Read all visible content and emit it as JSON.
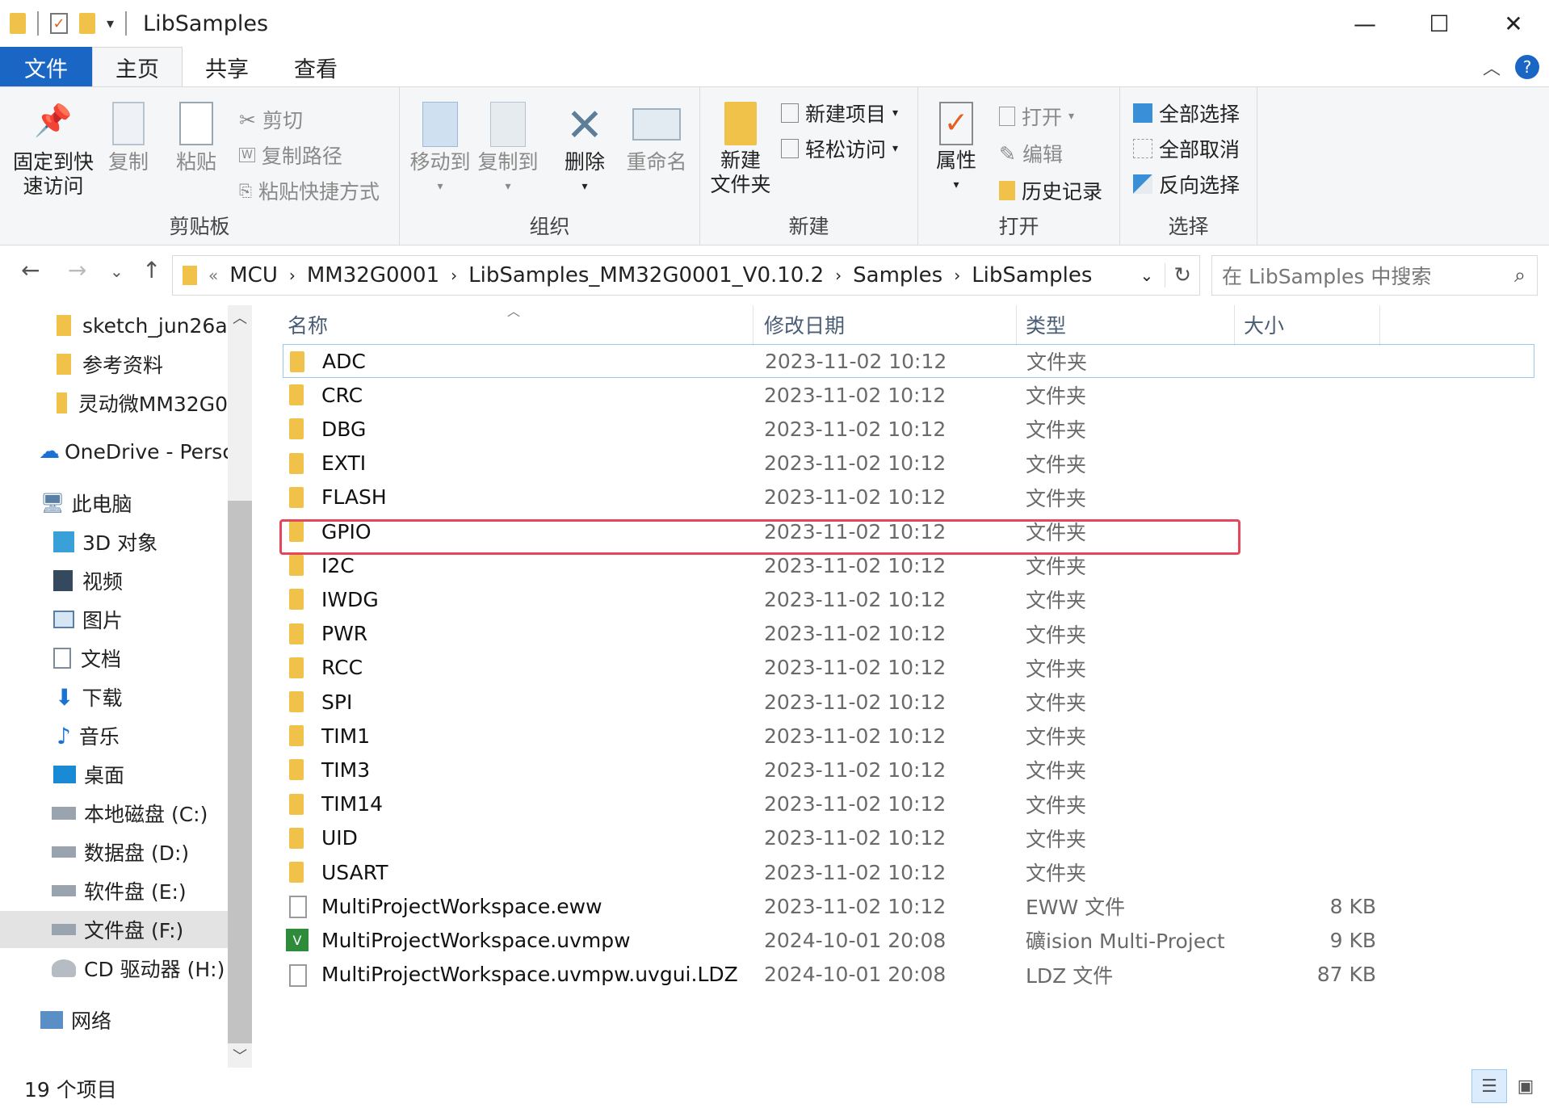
{
  "window": {
    "title": "LibSamples",
    "minimize": "—",
    "maximize": "☐",
    "close": "✕"
  },
  "tabs": [
    {
      "label": "文件"
    },
    {
      "label": "主页"
    },
    {
      "label": "共享"
    },
    {
      "label": "查看"
    }
  ],
  "ribbon": {
    "clipboard": {
      "label": "剪贴板",
      "pin": "固定到快\n速访问",
      "pin1": "固定到快",
      "pin2": "速访问",
      "copy": "复制",
      "paste": "粘贴",
      "cut": "剪切",
      "copy_path": "复制路径",
      "paste_shortcut": "粘贴快捷方式"
    },
    "organize": {
      "label": "组织",
      "move_to": "移动到",
      "copy_to": "复制到",
      "delete": "删除",
      "rename": "重命名"
    },
    "new": {
      "label": "新建",
      "new_folder1": "新建",
      "new_folder2": "文件夹",
      "new_item": "新建项目",
      "easy_access": "轻松访问"
    },
    "open": {
      "label": "打开",
      "properties": "属性",
      "open": "打开",
      "edit": "编辑",
      "history": "历史记录"
    },
    "select": {
      "label": "选择",
      "select_all": "全部选择",
      "select_none": "全部取消",
      "invert": "反向选择"
    }
  },
  "address": {
    "overflow": "«",
    "crumbs": [
      "MCU",
      "MM32G0001",
      "LibSamples_MM32G0001_V0.10.2",
      "Samples",
      "LibSamples"
    ],
    "search_placeholder": "在 LibSamples 中搜索"
  },
  "sidebar": {
    "items": [
      {
        "label": "sketch_jun26a"
      },
      {
        "label": "参考资料"
      },
      {
        "label": "灵动微MM32G0"
      },
      {
        "label": "OneDrive - Persc"
      },
      {
        "label": "此电脑"
      },
      {
        "label": "3D 对象"
      },
      {
        "label": "视频"
      },
      {
        "label": "图片"
      },
      {
        "label": "文档"
      },
      {
        "label": "下载"
      },
      {
        "label": "音乐"
      },
      {
        "label": "桌面"
      },
      {
        "label": "本地磁盘 (C:)"
      },
      {
        "label": "数据盘 (D:)"
      },
      {
        "label": "软件盘 (E:)"
      },
      {
        "label": "文件盘 (F:)"
      },
      {
        "label": "CD 驱动器 (H:)"
      },
      {
        "label": "网络"
      }
    ]
  },
  "columns": {
    "name": "名称",
    "date": "修改日期",
    "type": "类型",
    "size": "大小"
  },
  "files": [
    {
      "name": "ADC",
      "date": "2023-11-02 10:12",
      "type": "文件夹",
      "size": ""
    },
    {
      "name": "CRC",
      "date": "2023-11-02 10:12",
      "type": "文件夹",
      "size": ""
    },
    {
      "name": "DBG",
      "date": "2023-11-02 10:12",
      "type": "文件夹",
      "size": ""
    },
    {
      "name": "EXTI",
      "date": "2023-11-02 10:12",
      "type": "文件夹",
      "size": ""
    },
    {
      "name": "FLASH",
      "date": "2023-11-02 10:12",
      "type": "文件夹",
      "size": ""
    },
    {
      "name": "GPIO",
      "date": "2023-11-02 10:12",
      "type": "文件夹",
      "size": ""
    },
    {
      "name": "I2C",
      "date": "2023-11-02 10:12",
      "type": "文件夹",
      "size": ""
    },
    {
      "name": "IWDG",
      "date": "2023-11-02 10:12",
      "type": "文件夹",
      "size": ""
    },
    {
      "name": "PWR",
      "date": "2023-11-02 10:12",
      "type": "文件夹",
      "size": ""
    },
    {
      "name": "RCC",
      "date": "2023-11-02 10:12",
      "type": "文件夹",
      "size": ""
    },
    {
      "name": "SPI",
      "date": "2023-11-02 10:12",
      "type": "文件夹",
      "size": ""
    },
    {
      "name": "TIM1",
      "date": "2023-11-02 10:12",
      "type": "文件夹",
      "size": ""
    },
    {
      "name": "TIM3",
      "date": "2023-11-02 10:12",
      "type": "文件夹",
      "size": ""
    },
    {
      "name": "TIM14",
      "date": "2023-11-02 10:12",
      "type": "文件夹",
      "size": ""
    },
    {
      "name": "UID",
      "date": "2023-11-02 10:12",
      "type": "文件夹",
      "size": ""
    },
    {
      "name": "USART",
      "date": "2023-11-02 10:12",
      "type": "文件夹",
      "size": ""
    },
    {
      "name": "MultiProjectWorkspace.eww",
      "date": "2023-11-02 10:12",
      "type": "EWW 文件",
      "size": "8 KB"
    },
    {
      "name": "MultiProjectWorkspace.uvmpw",
      "date": "2024-10-01 20:08",
      "type": "礦ision Multi-Project",
      "size": "9 KB"
    },
    {
      "name": "MultiProjectWorkspace.uvmpw.uvgui.LDZ",
      "date": "2024-10-01 20:08",
      "type": "LDZ 文件",
      "size": "87 KB"
    }
  ],
  "status": {
    "count": "19 个项目"
  },
  "colors": {
    "accent": "#1966c5",
    "highlight_box": "#e4475b",
    "folder": "#f0c24a"
  }
}
